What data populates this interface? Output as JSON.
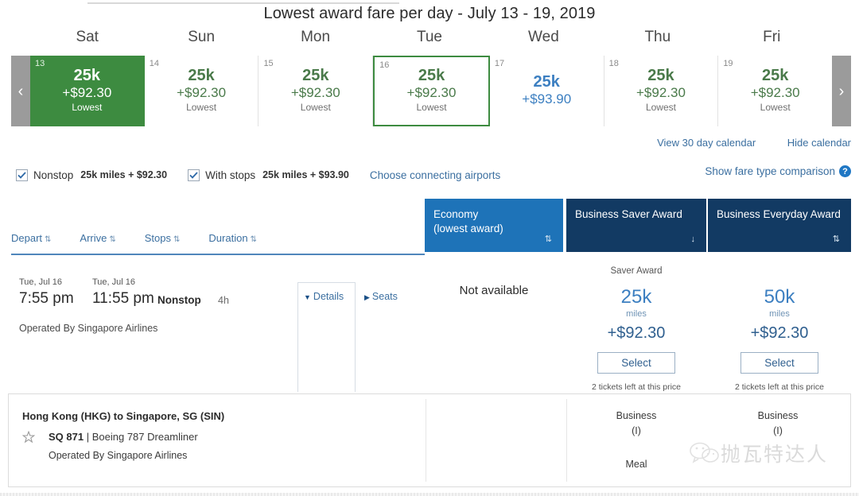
{
  "calendar": {
    "title": "Lowest award fare per day - July 13 - 19, 2019",
    "prev_arrow": "‹",
    "next_arrow": "›",
    "weekdays": [
      "Sat",
      "Sun",
      "Mon",
      "Tue",
      "Wed",
      "Thu",
      "Fri"
    ],
    "days": [
      {
        "num": "13",
        "miles": "25k",
        "cash": "+$92.30",
        "tag": "Lowest",
        "state": "selected"
      },
      {
        "num": "14",
        "miles": "25k",
        "cash": "+$92.30",
        "tag": "Lowest",
        "state": "normal"
      },
      {
        "num": "15",
        "miles": "25k",
        "cash": "+$92.30",
        "tag": "Lowest",
        "state": "normal"
      },
      {
        "num": "16",
        "miles": "25k",
        "cash": "+$92.30",
        "tag": "Lowest",
        "state": "focused"
      },
      {
        "num": "17",
        "miles": "25k",
        "cash": "+$93.90",
        "tag": "",
        "state": "blue"
      },
      {
        "num": "18",
        "miles": "25k",
        "cash": "+$92.30",
        "tag": "Lowest",
        "state": "normal"
      },
      {
        "num": "19",
        "miles": "25k",
        "cash": "+$92.30",
        "tag": "Lowest",
        "state": "normal"
      }
    ],
    "links": {
      "view30": "View 30 day calendar",
      "hide": "Hide calendar"
    },
    "colors": {
      "selected_green": "#3d8b40",
      "green_text": "#4a7a4a",
      "blue_text": "#3c7fc1",
      "arrow_gray": "#9b9b9b"
    }
  },
  "filters": {
    "nonstop": {
      "label": "Nonstop",
      "value": "25k miles + $92.30",
      "checked": true
    },
    "with_stops": {
      "label": "With stops",
      "value": "25k miles + $93.90",
      "checked": true
    },
    "connecting_link": "Choose connecting airports",
    "fare_compare": "Show fare type comparison",
    "help_glyph": "?"
  },
  "fare_columns": [
    {
      "line1": "Economy",
      "line2": "(lowest award)",
      "sort": "⇅",
      "style": "active"
    },
    {
      "line1": "Business Saver Award",
      "line2": "",
      "sort": "↓",
      "style": "dark"
    },
    {
      "line1": "Business Everyday Award",
      "line2": "",
      "sort": "⇅",
      "style": "dark"
    }
  ],
  "sort_bar": [
    {
      "label": "Depart",
      "arrows": "⇅"
    },
    {
      "label": "Arrive",
      "arrows": "⇅"
    },
    {
      "label": "Stops",
      "arrows": "⇅"
    },
    {
      "label": "Duration",
      "arrows": "⇅"
    }
  ],
  "flight": {
    "depart_date": "Tue, Jul 16",
    "depart_time": "7:55 pm",
    "arrive_date": "Tue, Jul 16",
    "arrive_time": "11:55 pm",
    "stops": "Nonstop",
    "duration": "4h",
    "operated_by": "Operated By Singapore Airlines",
    "details_label": "Details",
    "seats_label": "Seats",
    "details_caret": "▼",
    "seats_caret": "▶"
  },
  "fares": {
    "economy": {
      "status": "Not available"
    },
    "saver": {
      "kicker": "Saver Award",
      "miles": "25k",
      "miles_unit": "miles",
      "cash": "+$92.30",
      "select": "Select",
      "note": "2 tickets left at this price"
    },
    "everyday": {
      "kicker": "",
      "miles": "50k",
      "miles_unit": "miles",
      "cash": "+$92.30",
      "select": "Select",
      "note": "2 tickets left at this price"
    }
  },
  "detail_panel": {
    "route": "Hong Kong (HKG) to Singapore, SG (SIN)",
    "flight_number": "SQ 871",
    "separator": "|",
    "aircraft": "Boeing 787 Dreamliner",
    "operated_by": "Operated By Singapore Airlines",
    "saver_cabin": "Business",
    "saver_class": "(I)",
    "saver_meal": "Meal",
    "everyday_cabin": "Business",
    "everyday_class": "(I)",
    "everyday_meal": ""
  },
  "watermark": {
    "text": "抛瓦特达人"
  }
}
